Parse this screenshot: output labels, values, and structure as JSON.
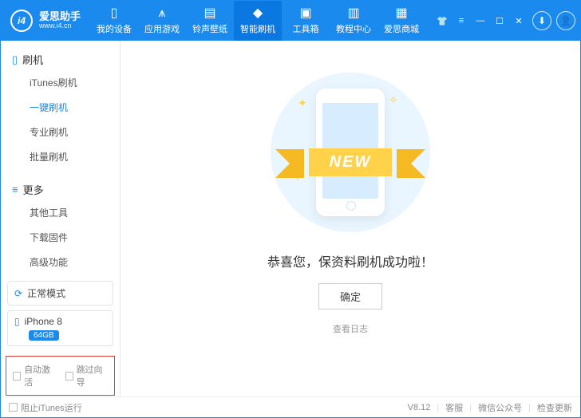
{
  "header": {
    "brand": "爱思助手",
    "url": "www.i4.cn",
    "tabs": [
      "我的设备",
      "应用游戏",
      "铃声壁纸",
      "智能刷机",
      "工具箱",
      "教程中心",
      "爱思商城"
    ]
  },
  "sidebar": {
    "groups": [
      {
        "title": "刷机",
        "items": [
          "iTunes刷机",
          "一键刷机",
          "专业刷机",
          "批量刷机"
        ]
      },
      {
        "title": "更多",
        "items": [
          "其他工具",
          "下载固件",
          "高级功能"
        ]
      }
    ],
    "mode": "正常模式",
    "device": {
      "name": "iPhone 8",
      "storage": "64GB"
    },
    "checks": [
      "自动激活",
      "跳过向导"
    ]
  },
  "main": {
    "ribbon": "NEW",
    "message": "恭喜您，保资料刷机成功啦！",
    "ok": "确定",
    "log": "查看日志"
  },
  "status": {
    "block_itunes": "阻止iTunes运行",
    "version": "V8.12",
    "support": "客服",
    "wechat": "微信公众号",
    "update": "检查更新"
  }
}
